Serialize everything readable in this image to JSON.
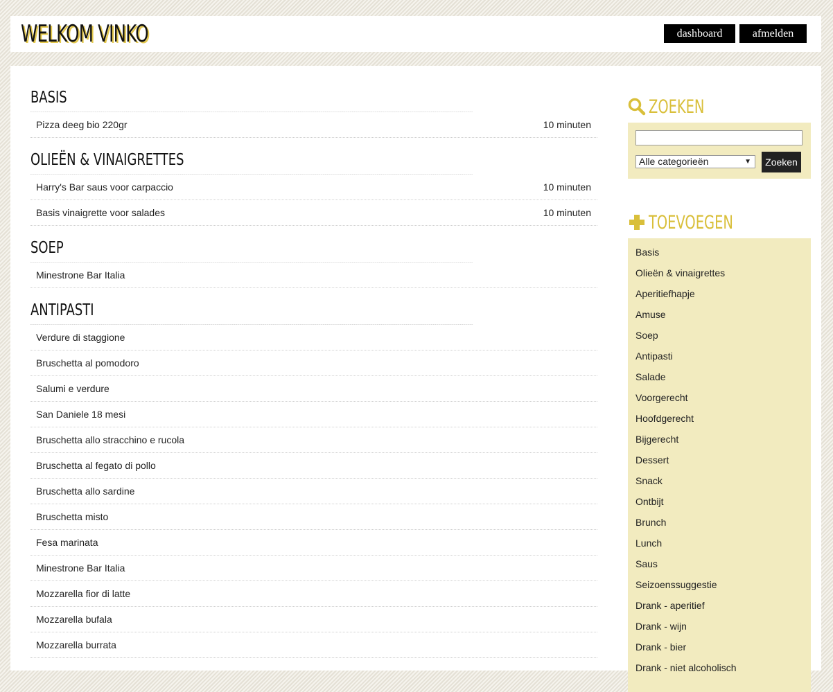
{
  "header": {
    "title": "WELKOM VINKO",
    "nav": {
      "dashboard": "dashboard",
      "logout": "afmelden"
    }
  },
  "categories": [
    {
      "title": "BASIS",
      "recipes": [
        {
          "name": "Pizza deeg bio 220gr",
          "time": "10 minuten"
        }
      ]
    },
    {
      "title": "OLIEËN & VINAIGRETTES",
      "recipes": [
        {
          "name": "Harry's Bar saus voor carpaccio",
          "time": "10 minuten"
        },
        {
          "name": "Basis vinaigrette voor salades",
          "time": "10 minuten"
        }
      ]
    },
    {
      "title": "SOEP",
      "recipes": [
        {
          "name": "Minestrone Bar Italia",
          "time": ""
        }
      ]
    },
    {
      "title": "ANTIPASTI",
      "recipes": [
        {
          "name": "Verdure di staggione",
          "time": ""
        },
        {
          "name": "Bruschetta al pomodoro",
          "time": ""
        },
        {
          "name": "Salumi e verdure",
          "time": ""
        },
        {
          "name": "San Daniele 18 mesi",
          "time": ""
        },
        {
          "name": "Bruschetta allo stracchino e rucola",
          "time": ""
        },
        {
          "name": "Bruschetta al fegato di pollo",
          "time": ""
        },
        {
          "name": "Bruschetta allo sardine",
          "time": ""
        },
        {
          "name": "Bruschetta misto",
          "time": ""
        },
        {
          "name": "Fesa marinata",
          "time": ""
        },
        {
          "name": "Minestrone Bar Italia",
          "time": ""
        },
        {
          "name": "Mozzarella fior di latte",
          "time": ""
        },
        {
          "name": "Mozzarella bufala",
          "time": ""
        },
        {
          "name": "Mozzarella burrata",
          "time": ""
        }
      ]
    }
  ],
  "search": {
    "heading": "ZOEKEN",
    "input_value": "",
    "category_selected": "Alle categorieën",
    "button_label": "Zoeken"
  },
  "add": {
    "heading": "TOEVOEGEN",
    "items": [
      "Basis",
      "Olieën & vinaigrettes",
      "Aperitiefhapje",
      "Amuse",
      "Soep",
      "Antipasti",
      "Salade",
      "Voorgerecht",
      "Hoofdgerecht",
      "Bijgerecht",
      "Dessert",
      "Snack",
      "Ontbijt",
      "Brunch",
      "Lunch",
      "Saus",
      "Seizoenssuggestie",
      "Drank - aperitief",
      "Drank - wijn",
      "Drank - bier",
      "Drank - niet alcoholisch"
    ]
  },
  "colors": {
    "accent": "#d9bf3a",
    "panel": "#f2ebbf",
    "button": "#000000"
  },
  "icons": {
    "search": "search-icon",
    "add": "plus-icon",
    "select": "chevron-down-icon"
  }
}
